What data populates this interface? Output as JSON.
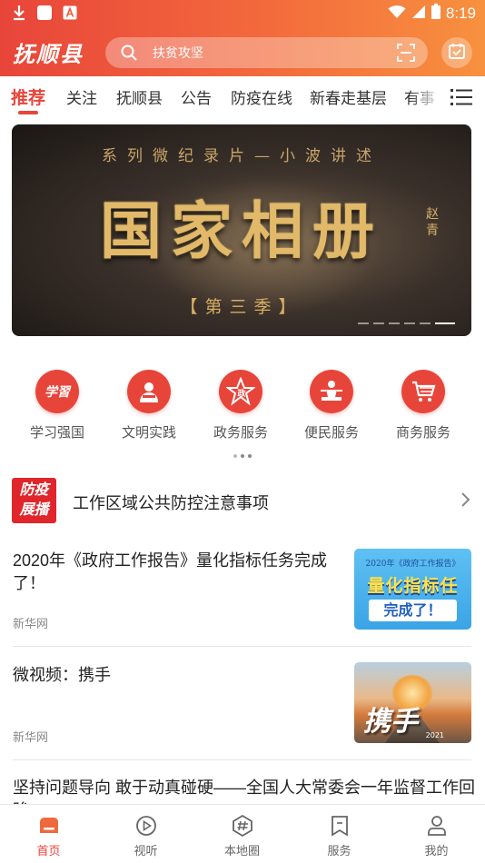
{
  "status_bar": {
    "time": "8:19"
  },
  "header": {
    "logo_text": "抚顺县",
    "search_placeholder": "扶贫攻坚"
  },
  "tabs": [
    {
      "label": "推荐",
      "active": true
    },
    {
      "label": "关注"
    },
    {
      "label": "抚顺县"
    },
    {
      "label": "公告"
    },
    {
      "label": "防疫在线"
    },
    {
      "label": "新春走基层"
    },
    {
      "label": "有事"
    }
  ],
  "banner": {
    "subtitle": "系列微纪录片—小波讲述",
    "title": "国家相册",
    "season": "【第三季】",
    "signature": "赵青",
    "slide_count": 6,
    "active_slide": 6
  },
  "services": [
    {
      "label": "学习强国",
      "icon": "xuexi-icon"
    },
    {
      "label": "文明实践",
      "icon": "civilization-icon"
    },
    {
      "label": "政务服务",
      "icon": "government-star-icon"
    },
    {
      "label": "便民服务",
      "icon": "convenience-icon"
    },
    {
      "label": "商务服务",
      "icon": "shopping-cart-icon"
    }
  ],
  "notice": {
    "badge_line1": "防疫",
    "badge_line2": "展播",
    "text": "工作区域公共防控注意事项"
  },
  "news": [
    {
      "title": "2020年《政府工作报告》量化指标任务完成了！",
      "source": "新华网",
      "thumb_caption_top": "2020年《政府工作报告》",
      "thumb_caption_main": "量化指标任务",
      "thumb_caption_box": "完成了！"
    },
    {
      "title": "微视频：携手",
      "source": "新华网",
      "thumb_caption_main": "携手",
      "thumb_caption_year": "2021"
    },
    {
      "title": "坚持问题导向 敢于动真碰硬——全国人大常委会一年监督工作回眸"
    }
  ],
  "bottom_nav": [
    {
      "label": "首页",
      "icon": "home-icon",
      "active": true
    },
    {
      "label": "视听",
      "icon": "play-icon"
    },
    {
      "label": "本地圈",
      "icon": "hashtag-icon"
    },
    {
      "label": "服务",
      "icon": "bookmark-icon"
    },
    {
      "label": "我的",
      "icon": "user-icon"
    }
  ],
  "colors": {
    "brand_red": "#e8453a",
    "header_gradient_end": "#f7913f"
  }
}
